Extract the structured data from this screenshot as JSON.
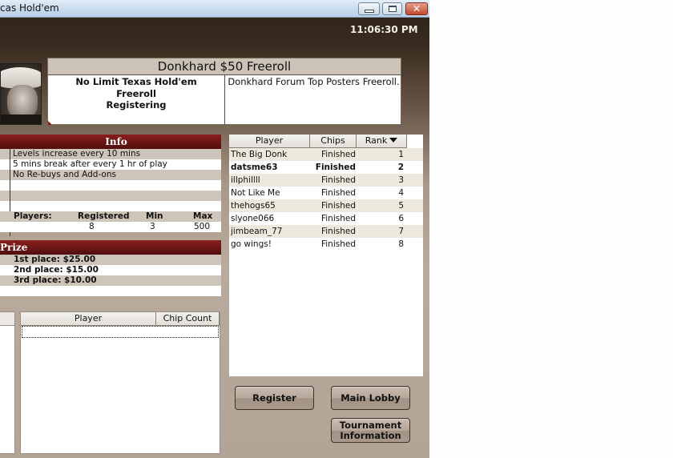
{
  "window": {
    "title": "cas Hold'em",
    "controls": {
      "minimize": "minimize",
      "maximize": "maximize",
      "close": "✕"
    }
  },
  "clock": "11:06:30 PM",
  "tournament": {
    "name": "Donkhard $50 Freeroll",
    "game": "No Limit Texas Hold'em",
    "type": "Freeroll",
    "status": "Registering",
    "description": "Donkhard Forum Top Posters Freeroll."
  },
  "info": {
    "header": "Info",
    "lines": [
      "Levels increase every 10 mins",
      "5 mins break after every 1 hr of play",
      "No Re-buys and Add-ons",
      "",
      ""
    ],
    "players_label": "Players:",
    "registered_label": "Registered",
    "min_label": "Min",
    "max_label": "Max",
    "registered": "8",
    "min": "3",
    "max": "500"
  },
  "prize": {
    "header": "Prize",
    "places": [
      "1st place:  $25.00",
      "2nd place:  $15.00",
      "3rd place:  $10.00"
    ]
  },
  "chip_table": {
    "columns": [
      "Player",
      "Chip Count"
    ],
    "rows": []
  },
  "standings": {
    "columns": [
      "Player",
      "Chips",
      "Rank"
    ],
    "sort_column": "Rank",
    "rows": [
      {
        "player": "The Big Donk",
        "chips": "Finished",
        "rank": "1",
        "bold": false
      },
      {
        "player": "datsme63",
        "chips": "Finished",
        "rank": "2",
        "bold": true
      },
      {
        "player": "illphillll",
        "chips": "Finished",
        "rank": "3",
        "bold": false
      },
      {
        "player": "Not Like Me",
        "chips": "Finished",
        "rank": "4",
        "bold": false
      },
      {
        "player": "thehogs65",
        "chips": "Finished",
        "rank": "5",
        "bold": false
      },
      {
        "player": "slyone066",
        "chips": "Finished",
        "rank": "6",
        "bold": false
      },
      {
        "player": "jimbeam_77",
        "chips": "Finished",
        "rank": "7",
        "bold": false
      },
      {
        "player": "go wings!",
        "chips": "Finished",
        "rank": "8",
        "bold": false
      }
    ]
  },
  "buttons": {
    "register": "Register",
    "main_lobby": "Main Lobby",
    "tournament_info_line1": "Tournament",
    "tournament_info_line2": "Information"
  },
  "colors": {
    "panel_header": "#6a1414",
    "row_dark": "#cdc4ba",
    "row_alt": "#ede9dd",
    "title_bar": "#c9dcef",
    "close_button": "#c4492b"
  }
}
